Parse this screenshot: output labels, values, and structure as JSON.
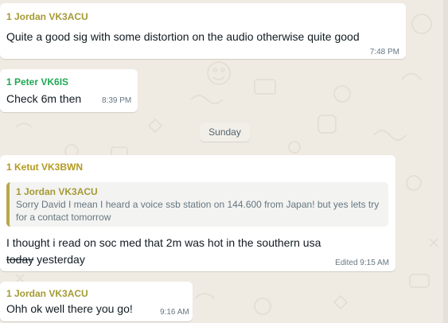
{
  "colors": {
    "chat_background": "#efeae2",
    "bubble": "#ffffff",
    "sender_jordan": "#a49a35",
    "sender_peter": "#1fa855",
    "sender_ketut": "#b49a1f",
    "timestamp": "#667781"
  },
  "messages": [
    {
      "sender": "1 Jordan VK3ACU",
      "text": "Quite a good sig with some distortion on the audio otherwise quite good",
      "time": "7:48 PM"
    },
    {
      "sender": "1 Peter VK6IS",
      "text": "Check 6m then",
      "time": "8:39 PM"
    },
    {
      "sender": "1 Ketut VK3BWN",
      "quote": {
        "sender": "1 Jordan VK3ACU",
        "text": "Sorry David I mean I heard a voice ssb station on 144.600 from Japan! but yes lets try for a contact tomorrow"
      },
      "line1": "I thought i read on soc med that 2m was hot in the southern usa",
      "line2_struck": "today",
      "line2_rest": " yesterday",
      "time": "Edited 9:15 AM"
    },
    {
      "sender": "1 Jordan VK3ACU",
      "text": "Ohh ok well there you go!",
      "time": "9:16 AM"
    }
  ],
  "day_separator": "Sunday"
}
